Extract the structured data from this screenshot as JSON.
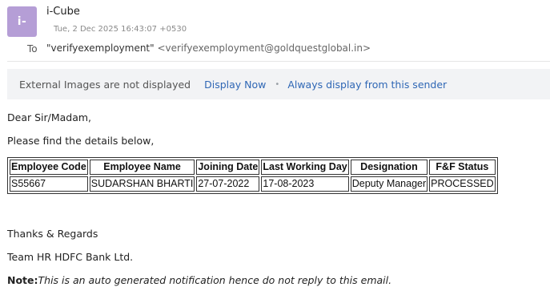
{
  "header": {
    "avatar_text": "i-",
    "avatar_color": "#b59ed6",
    "sender_name": "i-Cube",
    "sent_date": "Tue, 2 Dec 2025 16:43:07 +0530",
    "to_label": "To",
    "to_name": "\"verifyexemployment\"",
    "to_address": "<verifyexemployment@goldquestglobal.in>"
  },
  "image_bar": {
    "message": "External Images are not displayed",
    "display_now": "Display Now",
    "separator": "•",
    "always_display": "Always display from this sender",
    "link_color": "#2f67b5"
  },
  "body": {
    "greeting": "Dear Sir/Madam,",
    "intro": "Please find the details below,",
    "thanks": "Thanks & Regards",
    "team": "Team HR HDFC Bank Ltd.",
    "note_label": "Note:",
    "note_text": "This is an auto generated notification hence do not reply to this email."
  },
  "table": {
    "headers": [
      "Employee Code",
      "Employee Name",
      "Joining Date",
      "Last Working Day",
      "Designation",
      "F&F Status"
    ],
    "rows": [
      [
        "S55667",
        "SUDARSHAN BHARTI",
        "27-07-2022",
        "17-08-2023",
        "Deputy Manager",
        "PROCESSED"
      ]
    ]
  }
}
